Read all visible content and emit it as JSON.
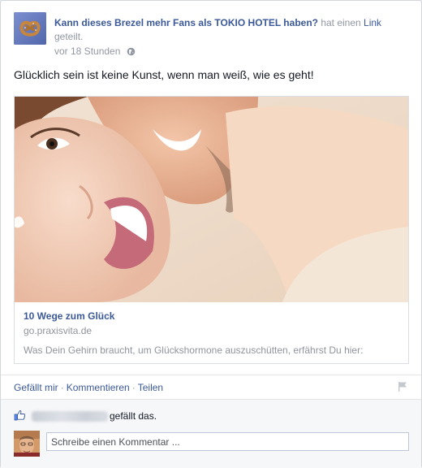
{
  "post": {
    "page_name": "Kann dieses Brezel mehr Fans als TOKIO HOTEL haben?",
    "action_prefix": " hat einen ",
    "action_link": "Link",
    "action_suffix": " geteilt.",
    "timestamp": "vor 18 Stunden",
    "audience_icon": "globe-icon",
    "message": "Glücklich sein ist keine Kunst, wenn man weiß, wie es geht!"
  },
  "link_card": {
    "title": "10 Wege zum Glück",
    "domain": "go.praxisvita.de",
    "description": "Was Dein Gehirn braucht, um Glückshormone auszuschütten, erfährst Du hier:"
  },
  "actions": {
    "like": "Gefällt mir",
    "comment": "Kommentieren",
    "share": "Teilen",
    "report_icon": "flag-icon"
  },
  "feedback": {
    "likes_suffix": "gefällt das.",
    "comment_placeholder": "Schreibe einen Kommentar ..."
  },
  "colors": {
    "link_blue": "#3b5998",
    "muted_gray": "#9197a3",
    "feedback_bg": "#f6f7f9"
  }
}
